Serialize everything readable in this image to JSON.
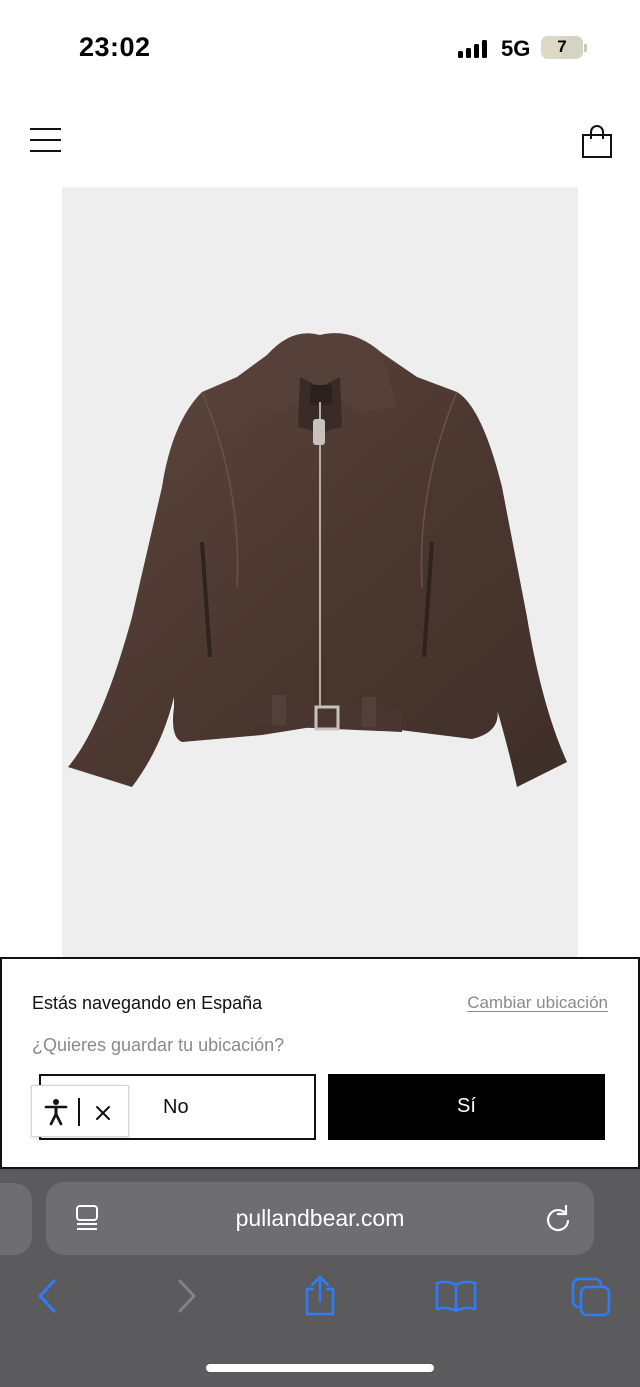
{
  "status_bar": {
    "time": "23:02",
    "network": "5G",
    "battery": "7",
    "icons": [
      "signal-icon",
      "battery-icon"
    ]
  },
  "header": {
    "icons": [
      "menu-icon",
      "shopping-bag-icon"
    ]
  },
  "product_gallery": {
    "image": "brown-leather-bomber-jacket",
    "image_count": 8,
    "active_index": 5
  },
  "location_banner": {
    "title": "Estás navegando en España",
    "change_link": "Cambiar ubicación",
    "question": "¿Quieres guardar tu ubicación?",
    "no_label": "No",
    "yes_label": "Sí",
    "accessibility_icons": [
      "accessibility-person-icon",
      "close-icon"
    ]
  },
  "browser": {
    "url": "pullandbear.com",
    "icons": [
      "reader-mode-icon",
      "reload-icon",
      "back-icon",
      "forward-icon",
      "share-icon",
      "bookmarks-icon",
      "tabs-icon"
    ]
  },
  "colors": {
    "accent_blue": "#2f7df6",
    "banner_button_dark": "#000000",
    "toolbar_bg": "#5b5b5e",
    "muted_text": "#8a8a8a",
    "jacket_brown": "#4e3a33"
  }
}
